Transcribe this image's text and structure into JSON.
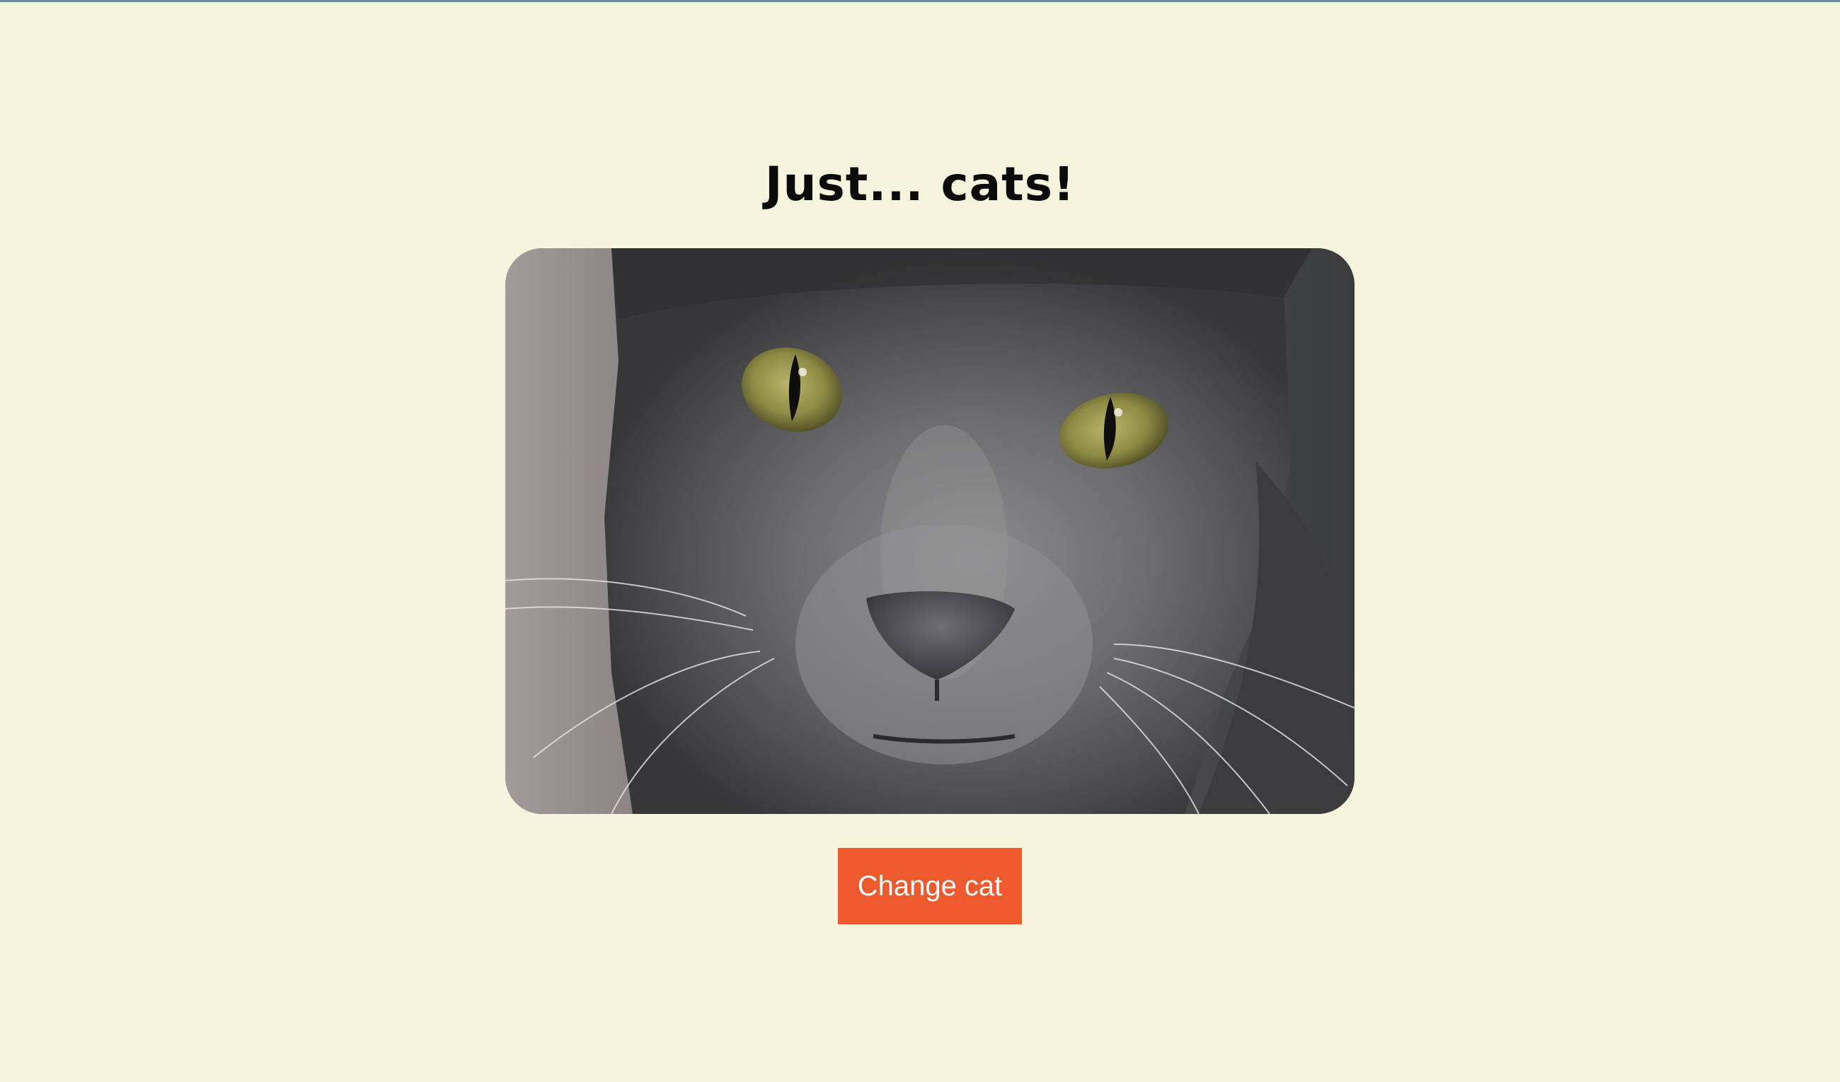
{
  "page": {
    "title": "Just... cats!",
    "background_color": "#f5f5de"
  },
  "photo": {
    "icon": "cat-photo",
    "subject": "grey cat close-up"
  },
  "actions": {
    "change_label": "Change cat",
    "button_color": "#ed5a2e"
  }
}
